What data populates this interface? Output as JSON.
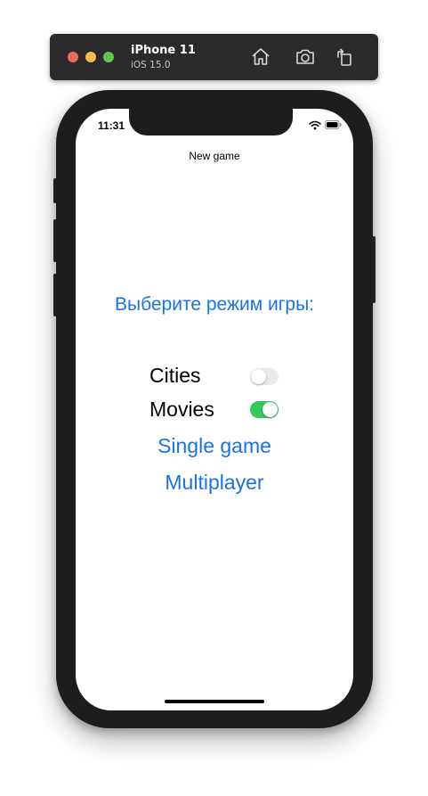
{
  "simulator": {
    "device_name": "iPhone 11",
    "os_version": "iOS 15.0",
    "toolbar_icons": [
      "home-icon",
      "screenshot-icon",
      "rotate-icon"
    ]
  },
  "status_bar": {
    "time": "11:31"
  },
  "nav": {
    "title": "New game"
  },
  "main": {
    "prompt": "Выберите режим игры:",
    "options": [
      {
        "label": "Cities",
        "enabled": false
      },
      {
        "label": "Movies",
        "enabled": true
      }
    ],
    "single_game_label": "Single game",
    "multiplayer_label": "Multiplayer"
  },
  "colors": {
    "accent": "#1a72e8",
    "switch_on": "#34c759",
    "switch_off": "#e9e9eb"
  }
}
